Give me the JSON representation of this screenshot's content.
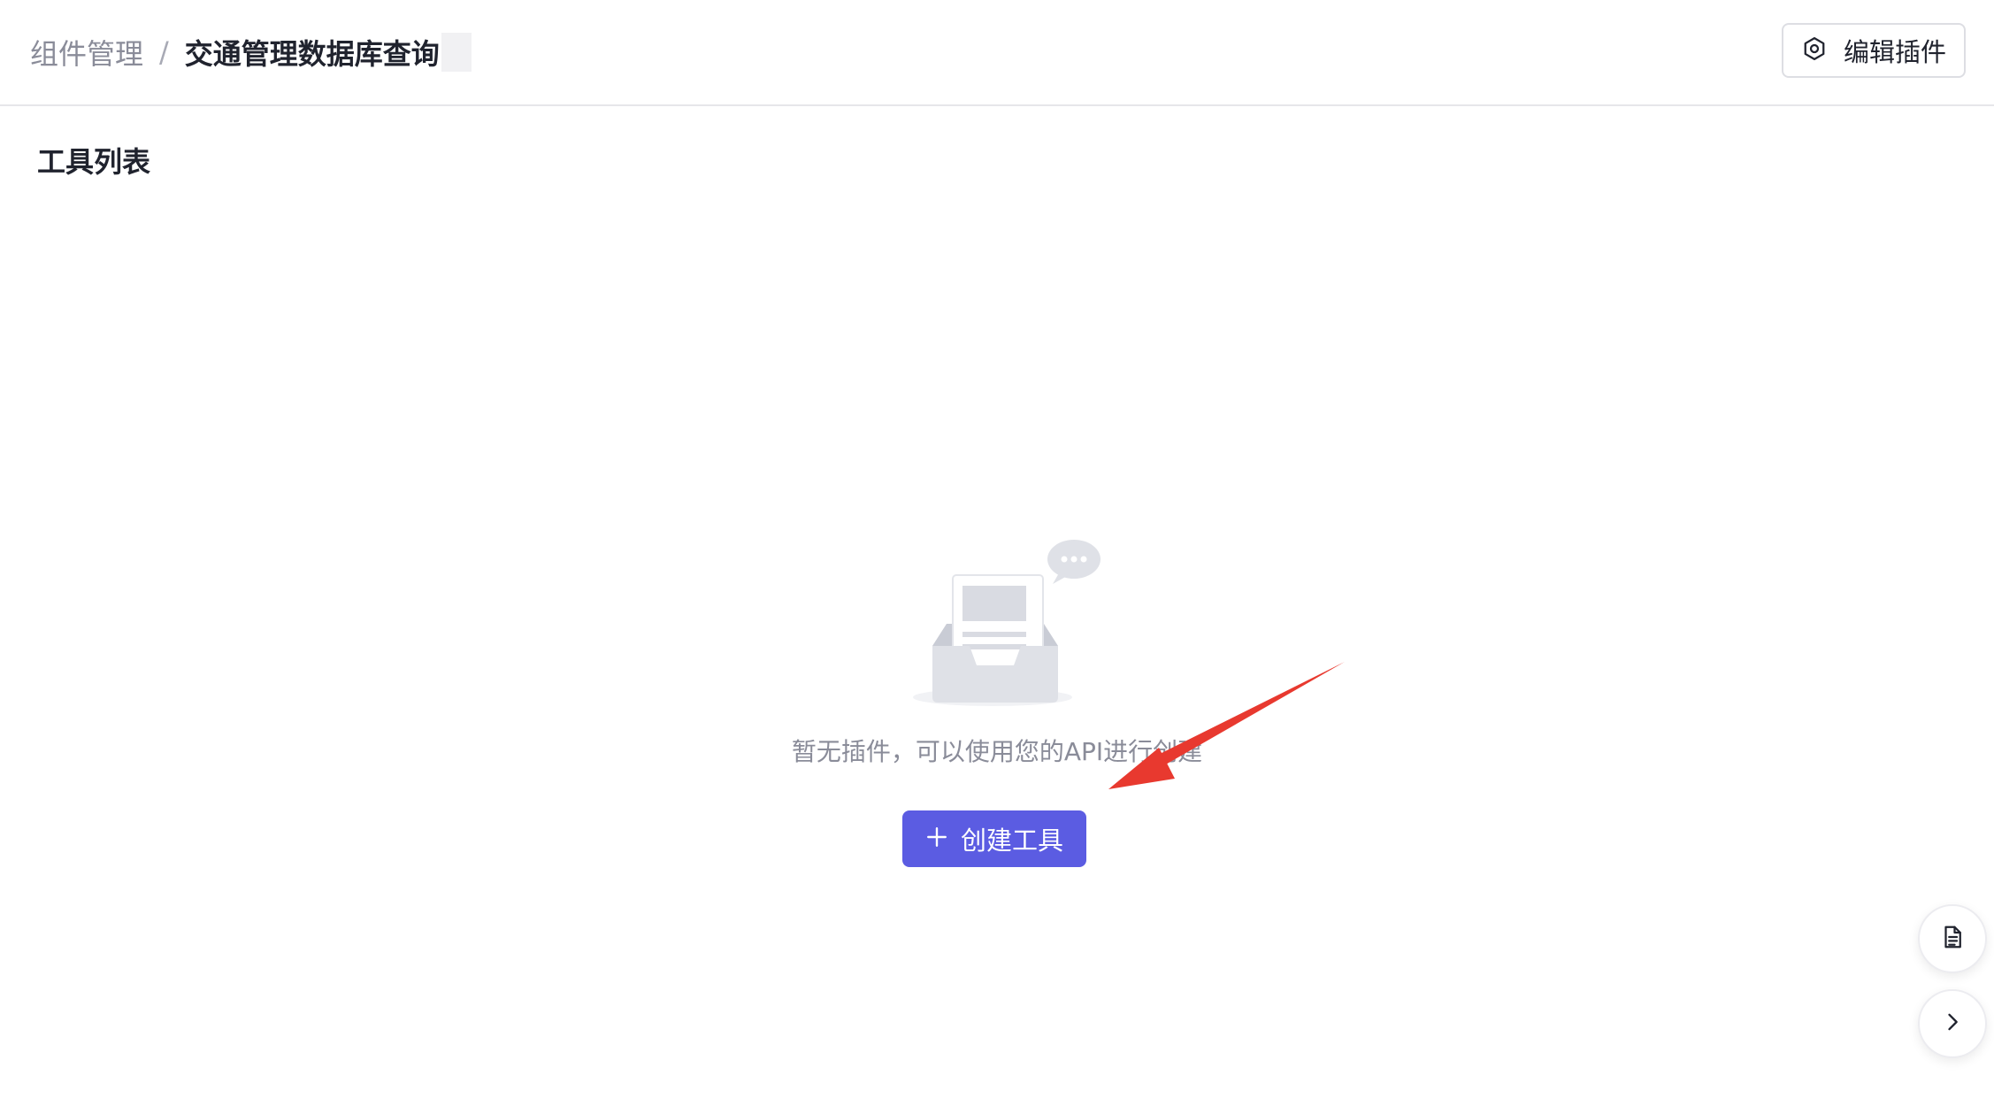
{
  "breadcrumb": {
    "parent": "组件管理",
    "separator": "/",
    "current": "交通管理数据库查询"
  },
  "header": {
    "edit_plugin_label": "编辑插件",
    "edit_plugin_icon": "gear-icon"
  },
  "main": {
    "section_title": "工具列表",
    "empty_text": "暂无插件，可以使用您的API进行创建",
    "create_button_label": "创建工具",
    "create_button_icon": "plus-icon"
  },
  "floating": {
    "doc_icon": "document-icon",
    "expand_icon": "chevron-right-icon"
  },
  "colors": {
    "accent": "#5b5ce2",
    "annotation_arrow": "#e8392f",
    "muted_text": "#8a8c99",
    "title_text": "#20232e"
  }
}
